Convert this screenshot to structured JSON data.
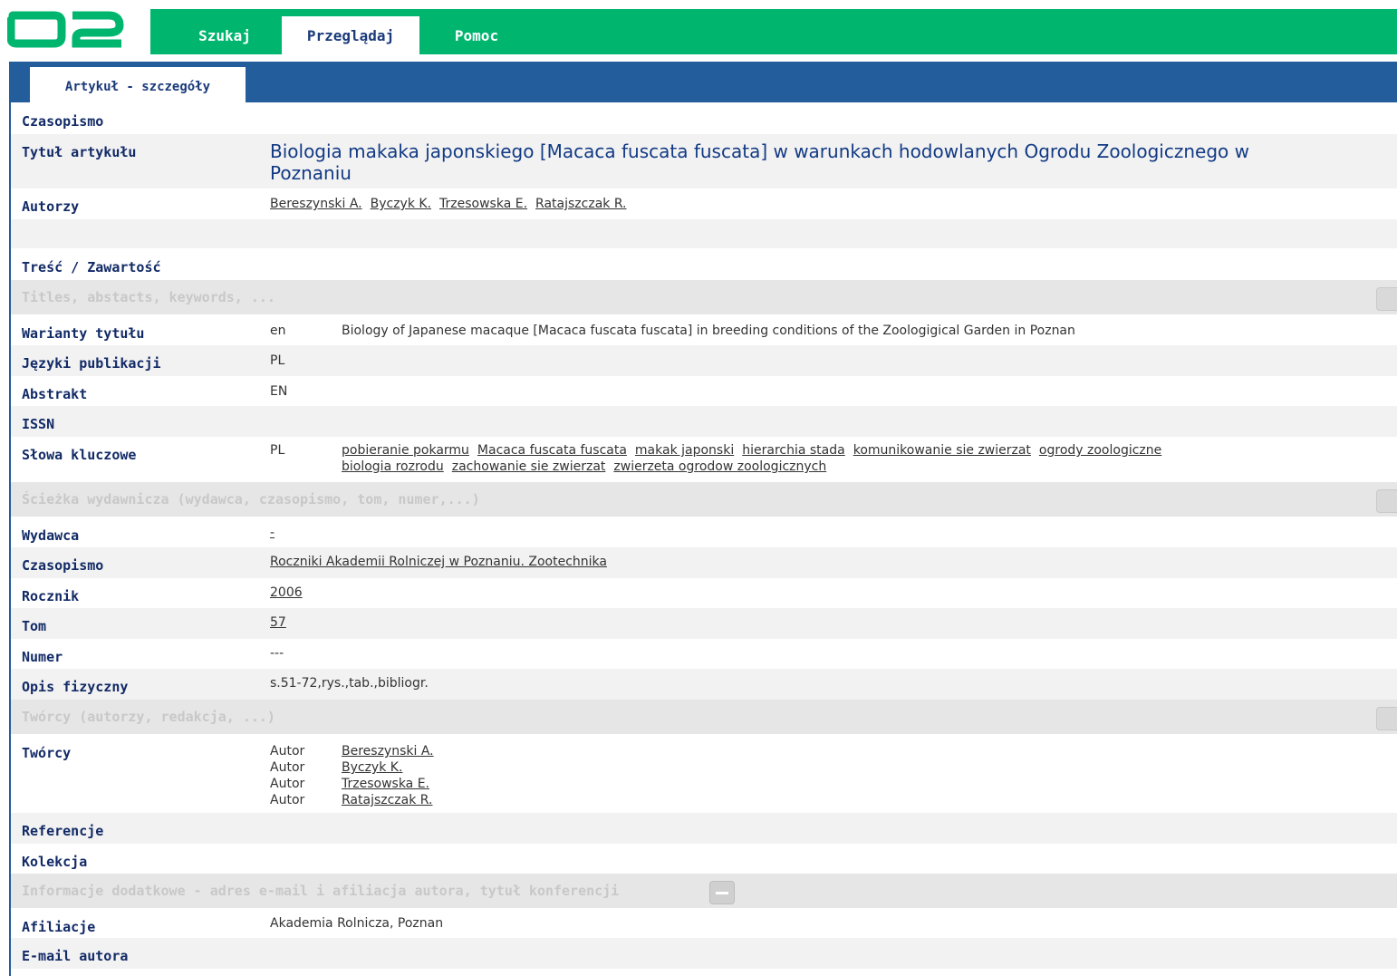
{
  "nav": {
    "tabs": [
      {
        "label": "Szukaj",
        "active": false
      },
      {
        "label": "Przeglądaj",
        "active": true
      },
      {
        "label": "Pomoc",
        "active": false
      }
    ],
    "subtab": "Artykuł - szczegóły"
  },
  "colors": {
    "green": "#00b66f",
    "blue": "#245d9c",
    "label": "#122a66",
    "title": "#123a84"
  },
  "labels": {
    "czasopismo_top": "Czasopismo",
    "tytul": "Tytuł artykułu",
    "autorzy": "Autorzy",
    "tresc": "Treść / Zawartość",
    "warianty": "Warianty tytułu",
    "jezyki": "Języki publikacji",
    "abstrakt": "Abstrakt",
    "issn": "ISSN",
    "slowa": "Słowa kluczowe",
    "wydawca": "Wydawca",
    "czasopismo": "Czasopismo",
    "rocznik": "Rocznik",
    "tom": "Tom",
    "numer": "Numer",
    "opis": "Opis fizyczny",
    "tworcy": "Twórcy",
    "referencje": "Referencje",
    "kolekcja": "Kolekcja",
    "afiliacje": "Afiliacje",
    "email": "E-mail autora"
  },
  "sections": {
    "titles": "Titles, abstacts, keywords, ...",
    "publishing": "Ścieżka wydawnicza (wydawca, czasopismo, tom, numer,...)",
    "creators": "Twórcy (autorzy, redakcja, ...)",
    "additional": "Informacje dodatkowe - adres e-mail i afiliacja autora, tytuł konferencji"
  },
  "article": {
    "title": "Biologia makaka japonskiego [Macaca fuscata fuscata] w warunkach hodowlanych Ogrodu Zoologicznego w Poznaniu",
    "authors": [
      "Bereszynski A.",
      "Byczyk K.",
      "Trzesowska E.",
      "Ratajszczak R."
    ],
    "title_variant_lang": "en",
    "title_variant": "Biology of Japanese macaque [Macaca fuscata fuscata] in breeding conditions of the Zoologigical Garden in Poznan",
    "languages": "PL",
    "abstract": "EN",
    "keywords_lang": "PL",
    "keywords_line1": [
      "pobieranie pokarmu",
      "Macaca fuscata fuscata",
      "makak japonski",
      "hierarchia stada",
      "komunikowanie sie zwierzat",
      "ogrody zoologiczne"
    ],
    "keywords_line2": [
      "biologia rozrodu",
      "zachowanie sie zwierzat",
      "zwierzeta ogrodow zoologicznych"
    ],
    "publisher": "-",
    "journal": "Roczniki Akademii Rolniczej w Poznaniu. Zootechnika",
    "year": "2006",
    "volume": "57",
    "number": "---",
    "physical": "s.51-72,rys.,tab.,bibliogr.",
    "creators": [
      {
        "role": "Autor",
        "name": "Bereszynski A."
      },
      {
        "role": "Autor",
        "name": "Byczyk K."
      },
      {
        "role": "Autor",
        "name": "Trzesowska E."
      },
      {
        "role": "Autor",
        "name": "Ratajszczak R."
      }
    ],
    "affiliation": "Akademia Rolnicza, Poznan"
  }
}
